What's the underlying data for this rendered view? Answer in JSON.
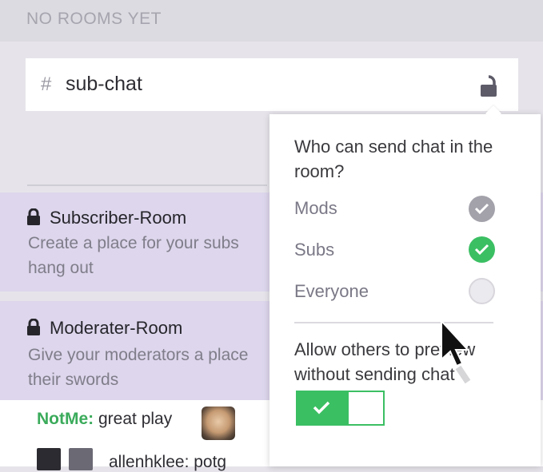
{
  "header": {
    "title": "NO ROOMS YET"
  },
  "room_input": {
    "hash": "#",
    "value": "sub-chat",
    "lock_icon": "unlock-icon"
  },
  "rooms": [
    {
      "name": "Subscriber-Room",
      "description": "Create a place for your subs hang out",
      "lock_icon": "lock-icon"
    },
    {
      "name": "Moderater-Room",
      "description": "Give your moderators a place their swords",
      "lock_icon": "lock-icon"
    }
  ],
  "chat": {
    "line1_user": "NotMe:",
    "line1_text": "great play",
    "line2_text": "allenhklee: potg"
  },
  "popover": {
    "question": "Who can send chat in the room?",
    "options": [
      {
        "label": "Mods",
        "state": "checked-grey"
      },
      {
        "label": "Subs",
        "state": "checked-green"
      },
      {
        "label": "Everyone",
        "state": "unchecked"
      }
    ],
    "preview_label": "Allow others to preview without sending chat",
    "preview_toggle": "on"
  },
  "colors": {
    "accent_green": "#3bbf63",
    "room_card": "#ddd6ec",
    "muted": "#a6a4ae"
  }
}
